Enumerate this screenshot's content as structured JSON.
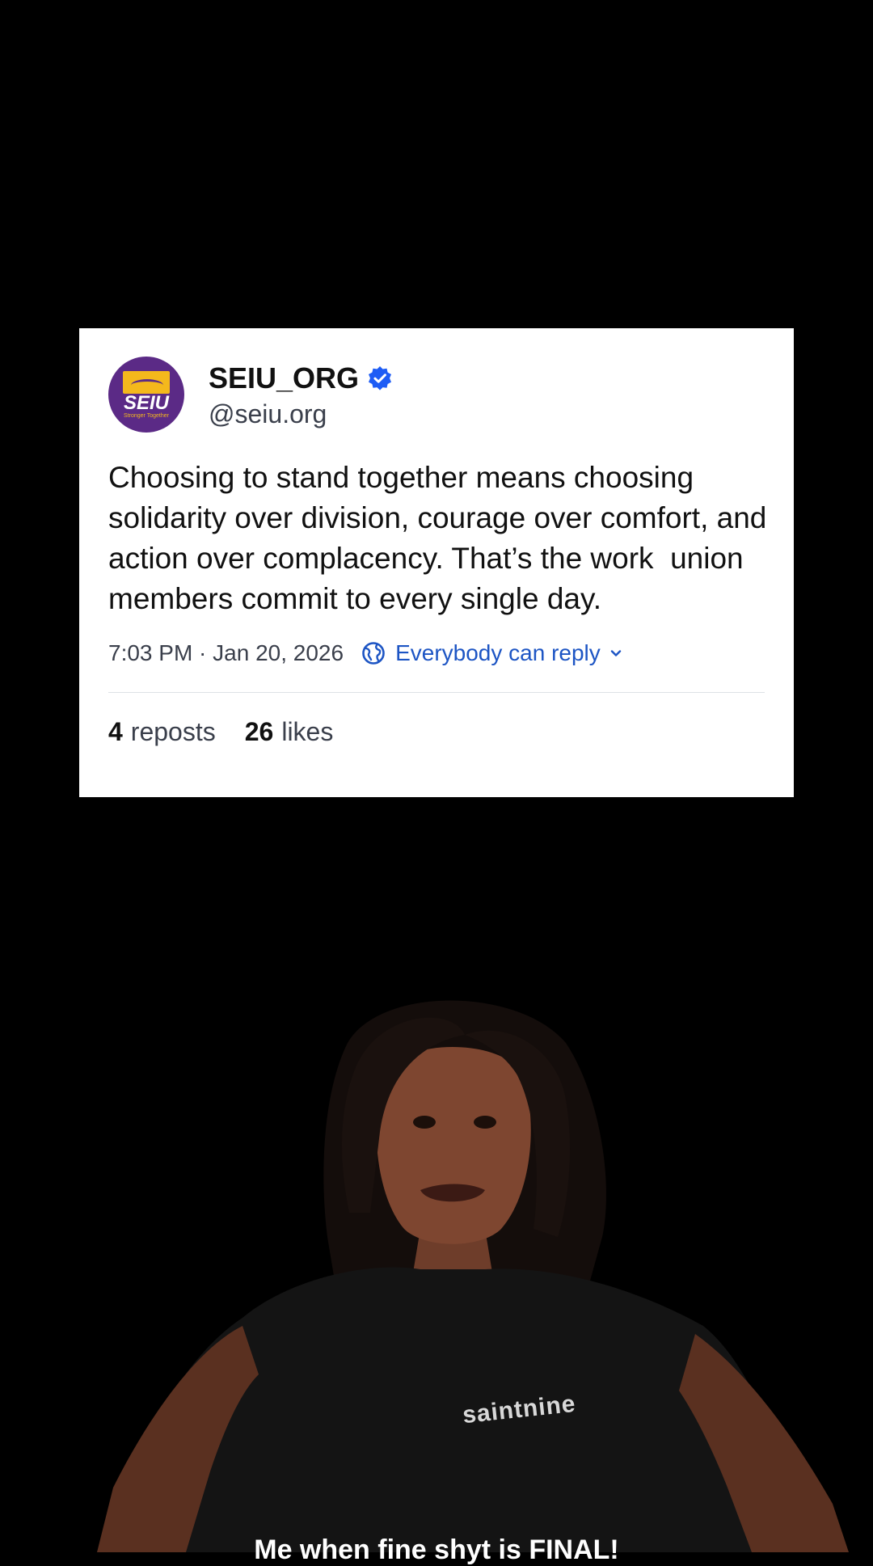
{
  "post": {
    "display_name": "SEIU_ORG",
    "handle": "@seiu.org",
    "avatar": {
      "logo_word": "SEIU",
      "logo_tagline": "Stronger Together",
      "brand_purple": "#5b2a86",
      "brand_gold": "#f4b81c"
    },
    "verified_icon": "verified-check-icon",
    "text": "Choosing to stand together means choosing solidarity over division, courage over comfort, and action over complacency. That’s the work  union members commit to every single day.",
    "timestamp": "7:03 PM · Jan 20, 2026",
    "reply_setting": {
      "label": "Everybody can reply",
      "icon": "globe-icon",
      "chevron": "chevron-down-icon"
    },
    "stats": {
      "reposts_count": "4",
      "reposts_label": "reposts",
      "likes_count": "26",
      "likes_label": "likes"
    },
    "colors": {
      "link_blue": "#1d55c4",
      "verified_blue": "#1d5cf5"
    }
  },
  "video": {
    "shirt_text": "saintnine",
    "caption": "Me when fine shyt is FINAL!"
  }
}
